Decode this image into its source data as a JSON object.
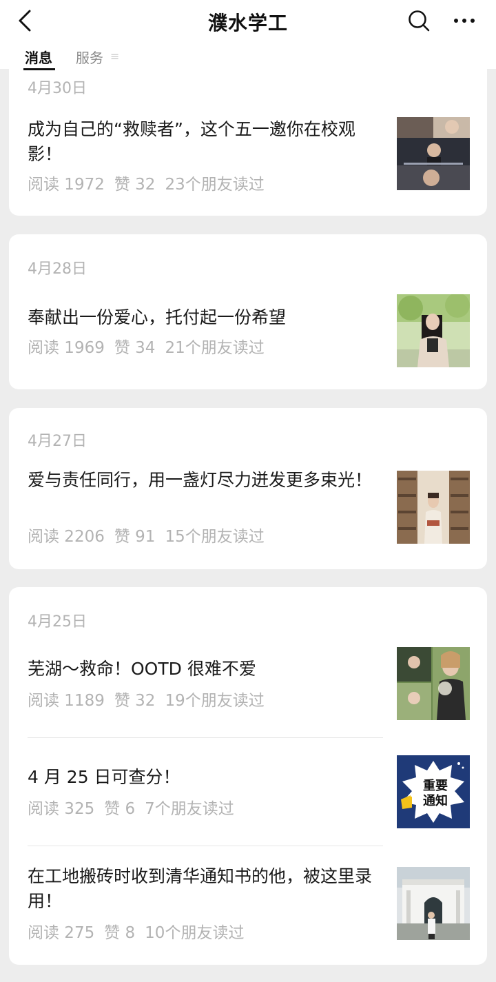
{
  "header": {
    "title": "濮水学工",
    "tabs": {
      "messages": "消息",
      "services": "服务"
    }
  },
  "groups": [
    {
      "date": "4月30日",
      "articles": [
        {
          "title": "成为自己的“救赎者”，这个五一邀你在校观影！",
          "reads": "阅读 1972",
          "likes": "赞 32",
          "friends": "23个朋友读过"
        }
      ]
    },
    {
      "date": "4月28日",
      "articles": [
        {
          "title": "奉献出一份爱心，托付起一份希望",
          "reads": "阅读 1969",
          "likes": "赞 34",
          "friends": "21个朋友读过"
        }
      ]
    },
    {
      "date": "4月27日",
      "articles": [
        {
          "title": "爱与责任同行，用一盏灯尽力迸发更多束光！",
          "reads": "阅读 2206",
          "likes": "赞 91",
          "friends": "15个朋友读过"
        }
      ]
    },
    {
      "date": "4月25日",
      "articles": [
        {
          "title": "芜湖～救命！OOTD 很难不爱",
          "reads": "阅读 1189",
          "likes": "赞 32",
          "friends": "19个朋友读过"
        },
        {
          "title": "4 月 25 日可查分！",
          "reads": "阅读 325",
          "likes": "赞 6",
          "friends": "7个朋友读过",
          "thumb_text": [
            "重要",
            "通知"
          ]
        },
        {
          "title": "在工地搬砖时收到清华通知书的他，被这里录用！",
          "reads": "阅读 275",
          "likes": "赞 8",
          "friends": "10个朋友读过"
        }
      ]
    }
  ],
  "colors": {
    "background": "#ededed",
    "card": "#ffffff",
    "muted": "#b3b3b3",
    "notice_blue": "#1f3a78",
    "notice_yellow": "#f3c21b"
  },
  "icons": [
    "back-arrow-icon",
    "search-icon",
    "more-icon",
    "menu-lines-icon"
  ]
}
